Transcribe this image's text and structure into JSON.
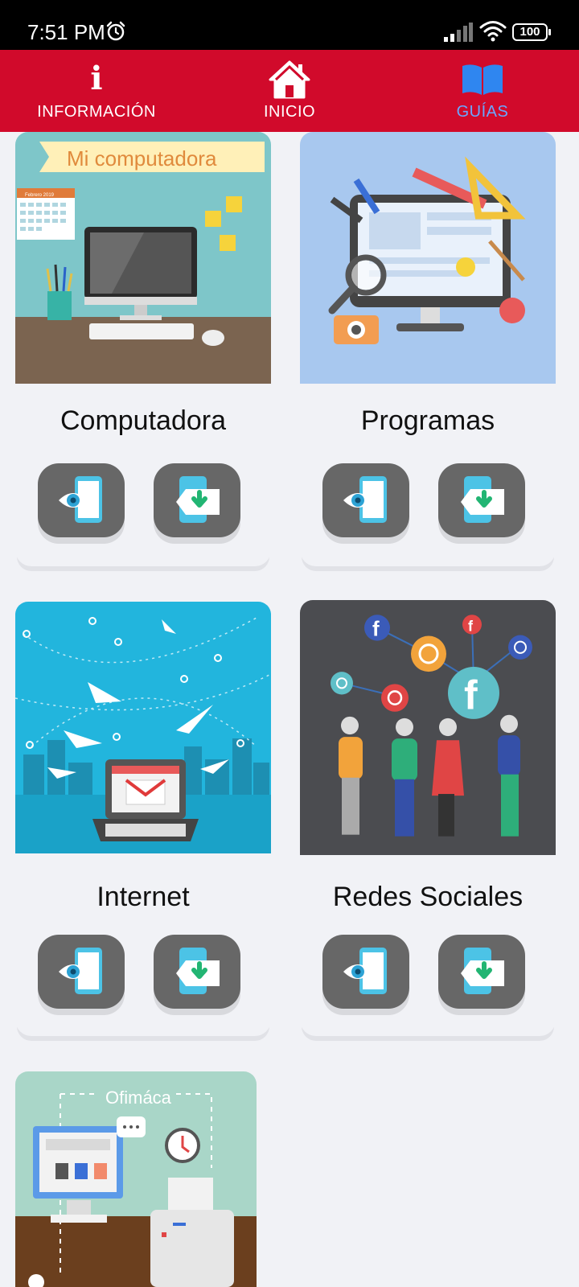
{
  "status_bar": {
    "time": "7:51 PM",
    "battery": "100",
    "icons": [
      "alarm-icon",
      "signal-icon",
      "wifi-icon",
      "battery-icon"
    ]
  },
  "header": {
    "tabs": [
      {
        "label": "INFORMACIÓN",
        "icon": "info-icon",
        "active": false
      },
      {
        "label": "INICIO",
        "icon": "home-icon",
        "active": false
      },
      {
        "label": "GUÍAS",
        "icon": "book-icon",
        "active": true
      }
    ],
    "colors": {
      "background": "#d10a2b",
      "active_tab": "#6aa6ff"
    }
  },
  "guides": [
    {
      "title": "Computadora",
      "image_text": "Mi computadora",
      "calendar_text": "Febrero 2019",
      "actions": [
        "view-guide",
        "download-guide"
      ]
    },
    {
      "title": "Programas",
      "image_text": "",
      "actions": [
        "view-guide",
        "download-guide"
      ]
    },
    {
      "title": "Internet",
      "image_text": "",
      "actions": [
        "view-guide",
        "download-guide"
      ]
    },
    {
      "title": "Redes Sociales",
      "image_text": "",
      "actions": [
        "view-guide",
        "download-guide"
      ]
    },
    {
      "title": "",
      "image_text": "Ofimáca",
      "actions": []
    }
  ]
}
